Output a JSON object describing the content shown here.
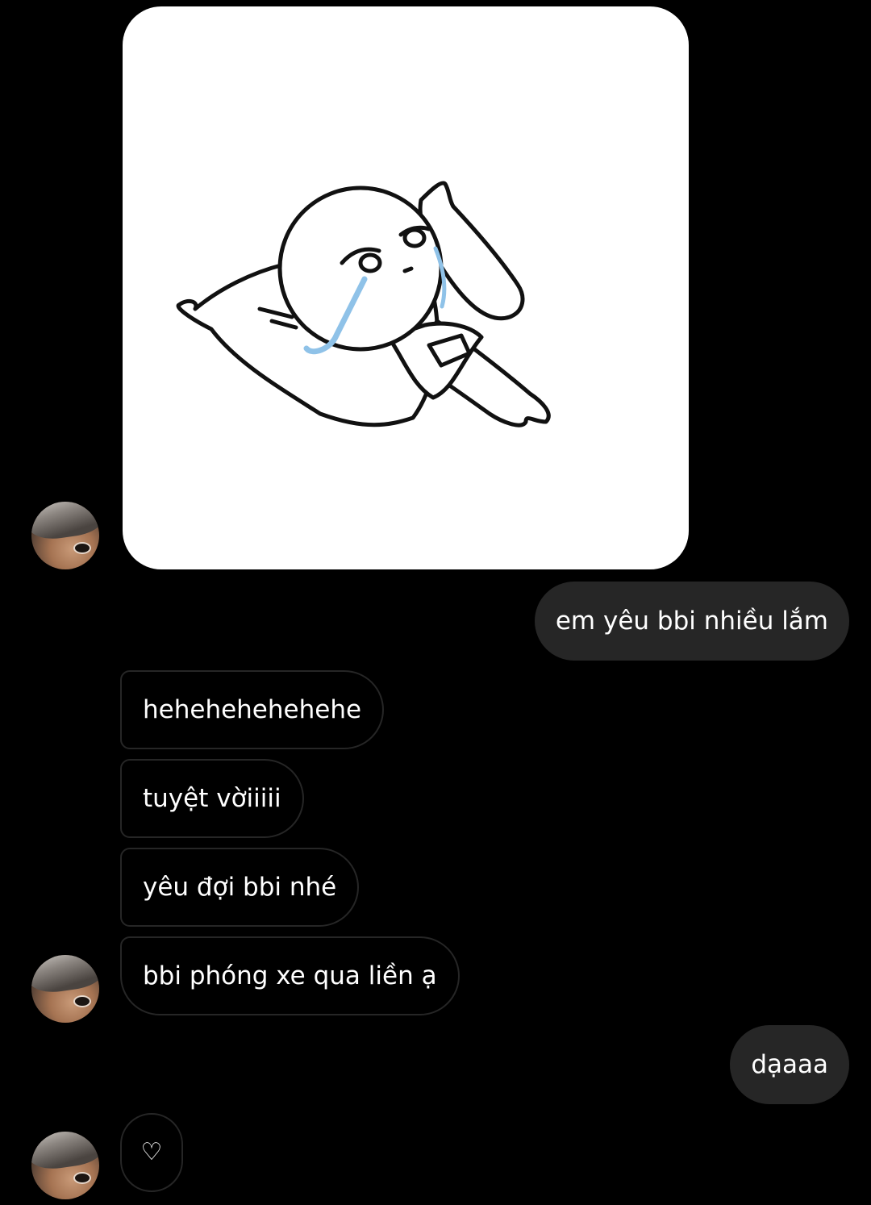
{
  "conversation": {
    "sticker_image": {
      "description": "crying-character-sticker"
    },
    "outgoing_1": "em yêu bbi nhiều lắm",
    "incoming_group": [
      "hehehehehehehe",
      "tuyệt vờiiiii",
      "yêu đợi bbi nhé",
      "bbi phóng xe qua liền ạ"
    ],
    "outgoing_2": "dạaaa",
    "reaction_message": "♡"
  },
  "colors": {
    "background": "#000000",
    "outgoing_bubble": "#262626",
    "incoming_border": "#262626",
    "text": "#ffffff",
    "tear": "#8fc2e8"
  }
}
